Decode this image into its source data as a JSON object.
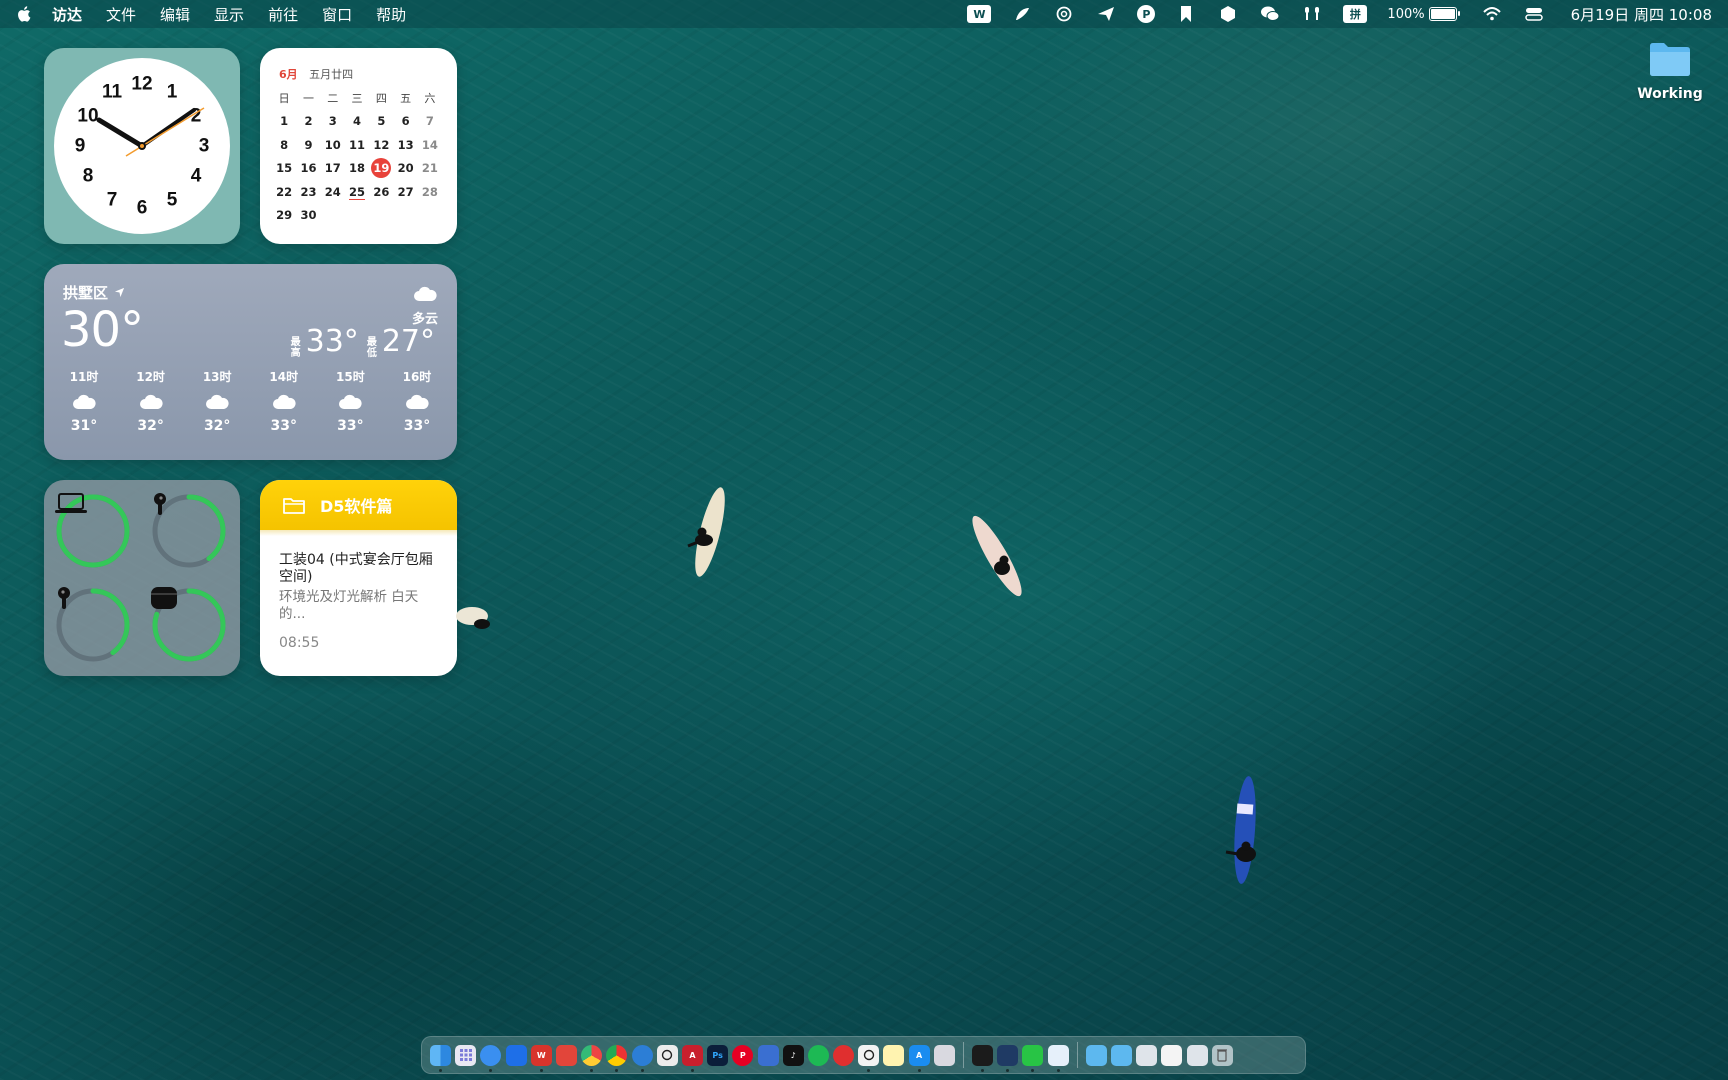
{
  "menubar": {
    "app_name": "访达",
    "items": [
      "文件",
      "编辑",
      "显示",
      "前往",
      "窗口",
      "帮助"
    ],
    "tray_pinyin": "拼",
    "tray_p": "P",
    "battery": "100%",
    "datetime": "6月19日 周四 10:08"
  },
  "calendar": {
    "month": "6月",
    "lunar": "五月廿四",
    "weekdays": [
      "日",
      "一",
      "二",
      "三",
      "四",
      "五",
      "六"
    ],
    "weeks": [
      [
        "1",
        "2",
        "3",
        "4",
        "5",
        "6",
        "7"
      ],
      [
        "8",
        "9",
        "10",
        "11",
        "12",
        "13",
        "14"
      ],
      [
        "15",
        "16",
        "17",
        "18",
        "19",
        "20",
        "21"
      ],
      [
        "22",
        "23",
        "24",
        "25",
        "26",
        "27",
        "28"
      ],
      [
        "29",
        "30",
        "",
        "",
        "",
        "",
        ""
      ]
    ],
    "today": "19",
    "marked": "25"
  },
  "weather": {
    "location": "拱墅区",
    "temp": "30°",
    "condition": "多云",
    "hi_label": "最高",
    "hi": "33°",
    "lo_label": "最低",
    "lo": "27°",
    "hours": [
      {
        "time": "11时",
        "temp": "31°"
      },
      {
        "time": "12时",
        "temp": "32°"
      },
      {
        "time": "13时",
        "temp": "32°"
      },
      {
        "time": "14时",
        "temp": "33°"
      },
      {
        "time": "15时",
        "temp": "33°"
      },
      {
        "time": "16时",
        "temp": "33°"
      }
    ]
  },
  "batteries": [
    {
      "device": "laptop-icon",
      "level": 1.0
    },
    {
      "device": "airpod-right-icon",
      "level": 0.4
    },
    {
      "device": "airpod-left-icon",
      "level": 0.4
    },
    {
      "device": "airpods-case-icon",
      "level": 0.8
    }
  ],
  "notes": {
    "folder": "D5软件篇",
    "note_title": "工装04 (中式宴会厅包厢空间)",
    "note_preview": "环境光及灯光解析 白天的...",
    "note_time": "08:55"
  },
  "desktop": {
    "folder_label": "Working"
  },
  "colors": {
    "accent_red": "#e8423a",
    "battery_green": "#34c759",
    "notes_yellow": "#ffd20a"
  }
}
